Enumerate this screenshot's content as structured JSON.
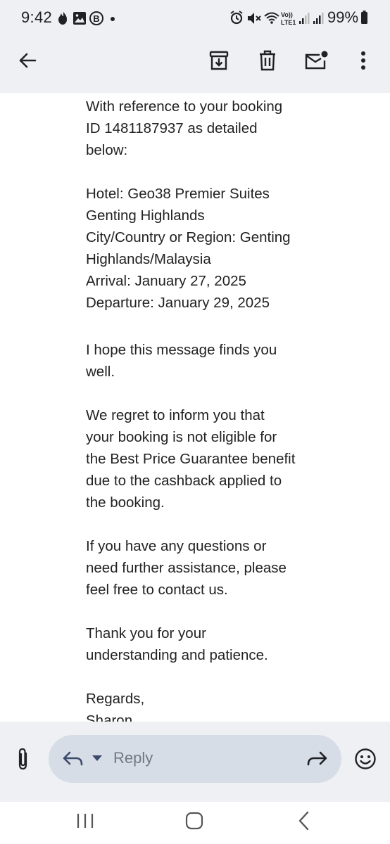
{
  "status_bar": {
    "time": "9:42",
    "battery": "99%",
    "left_icons": [
      "flame-icon",
      "image-icon",
      "b-circle-icon",
      "dot-icon"
    ],
    "right_icons": [
      "alarm-icon",
      "mute-icon",
      "wifi-icon",
      "volte-icon",
      "signal-icon",
      "signal-icon",
      "battery-icon"
    ]
  },
  "app_bar": {
    "icons": [
      "back-arrow-icon",
      "archive-icon",
      "delete-icon",
      "mark-unread-icon",
      "more-vert-icon"
    ]
  },
  "email": {
    "intro_line1": "With reference to your booking",
    "intro_line2": "ID 1481187937 as detailed",
    "intro_line3": "below:",
    "hotel_line1": "Hotel: Geo38 Premier Suites",
    "hotel_line2": "Genting Highlands",
    "city_line1": "City/Country or Region: Genting",
    "city_line2": "Highlands/Malaysia",
    "arrival": "Arrival: January 27, 2025",
    "departure": "Departure: January 29, 2025",
    "hope_line1": "I hope this message finds you",
    "hope_line2": "well.",
    "regret_line1": "We regret to inform you that",
    "regret_line2": "your booking is not eligible for",
    "regret_line3": "the Best Price Guarantee benefit",
    "regret_line4": "due to the cashback applied to",
    "regret_line5": "the booking.",
    "questions_line1": "If you have any questions or",
    "questions_line2": "need further assistance, please",
    "questions_line3": "feel free to contact us.",
    "thanks_line1": "Thank you for your",
    "thanks_line2": "understanding and patience.",
    "regards": "Regards,",
    "signature_partial": "Sharon"
  },
  "reply_bar": {
    "placeholder": "Reply",
    "icons": [
      "attachment-icon",
      "reply-icon",
      "dropdown-icon",
      "forward-icon",
      "emoji-icon"
    ]
  },
  "nav_bar": {
    "icons": [
      "recents-icon",
      "home-icon",
      "back-nav-icon"
    ]
  }
}
